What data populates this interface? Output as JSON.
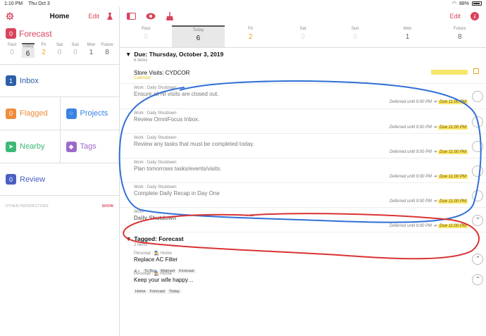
{
  "status": {
    "time": "1:10 PM",
    "date": "Thu Oct 3",
    "battery": "88%"
  },
  "sidebar": {
    "title": "Home",
    "edit_label": "Edit",
    "forecast": {
      "badge": "0",
      "label": "Forecast",
      "days": [
        {
          "label": "Past",
          "count": "0"
        },
        {
          "label": "Today",
          "count": "6"
        },
        {
          "label": "Fri",
          "count": "2"
        },
        {
          "label": "Sat",
          "count": "0"
        },
        {
          "label": "Sun",
          "count": "0"
        },
        {
          "label": "Mon",
          "count": "1"
        },
        {
          "label": "Future",
          "count": "8"
        }
      ]
    },
    "inbox": {
      "badge": "1",
      "label": "Inbox"
    },
    "flagged": {
      "badge": "0",
      "label": "Flagged"
    },
    "projects": {
      "label": "Projects"
    },
    "nearby": {
      "label": "Nearby"
    },
    "tags": {
      "label": "Tags"
    },
    "review": {
      "badge": "0",
      "label": "Review"
    },
    "other_perspectives": "OTHER PERSPECTIVES",
    "show_label": "SHOW"
  },
  "colors": {
    "accent": "#d9435b",
    "forecast": "#d9435b",
    "inbox": "#2b5fa8",
    "flagged": "#f08c3c",
    "projects": "#3a82e4",
    "nearby": "#3cb876",
    "tags": "#9b6ac9",
    "review": "#4a5fc1",
    "due": "#f8e66b"
  },
  "main": {
    "edit_label": "Edit",
    "days": [
      {
        "label": "Past",
        "count": "0"
      },
      {
        "label": "Today",
        "count": "6"
      },
      {
        "label": "Fri",
        "count": "2"
      },
      {
        "label": "Sat",
        "count": "0"
      },
      {
        "label": "Sun",
        "count": "0"
      },
      {
        "label": "Mon",
        "count": "1"
      },
      {
        "label": "Future",
        "count": "8"
      }
    ],
    "due_section": {
      "title": "Due: Thursday, October 3, 2019",
      "count": "6 items",
      "store_visit": {
        "name": "Store Visits: CYDCOR",
        "sub": "Calendar"
      },
      "tasks": [
        {
          "ctx": "Work : Daily Shutdown",
          "name": "Ensure all NI visits are closed out.",
          "deferred": "Deferred until 9:00 PM",
          "due": "Due 11:00 PM"
        },
        {
          "ctx": "Work : Daily Shutdown",
          "name": "Review OmniFocus Inbox.",
          "deferred": "Deferred until 9:00 PM",
          "due": "Due 11:00 PM"
        },
        {
          "ctx": "Work : Daily Shutdown",
          "name": "Review any tasks that must be completed today.",
          "deferred": "Deferred until 9:00 PM",
          "due": "Due 11:00 PM"
        },
        {
          "ctx": "Work : Daily Shutdown",
          "name": "Plan tomorrows tasks/events/visits.",
          "deferred": "Deferred until 9:00 PM",
          "due": "Due 11:00 PM"
        },
        {
          "ctx": "Work : Daily Shutdown",
          "name": "Complete Daily Recap in Day One",
          "deferred": "Deferred until 9:00 PM",
          "due": "Due 11:00 PM"
        }
      ],
      "project": {
        "ctx": "Work",
        "name": "Daily Shutdown",
        "deferred": "Deferred until 9:00 PM",
        "due": "Due 11:00 PM"
      }
    },
    "tagged_section": {
      "title": "Tagged: Forecast",
      "count": "2 items",
      "tasks": [
        {
          "ctx": "Personal : 👨‍🔧 Home",
          "name": "Replace AC Filter",
          "tags": [
            "To Buy",
            "Walmart",
            "Forecast"
          ]
        },
        {
          "ctx": "Personal : 👨‍🔧 Home",
          "name": "Keep your wife happy…",
          "tags": [
            "Home",
            "Forecast",
            "Today"
          ]
        }
      ]
    }
  }
}
